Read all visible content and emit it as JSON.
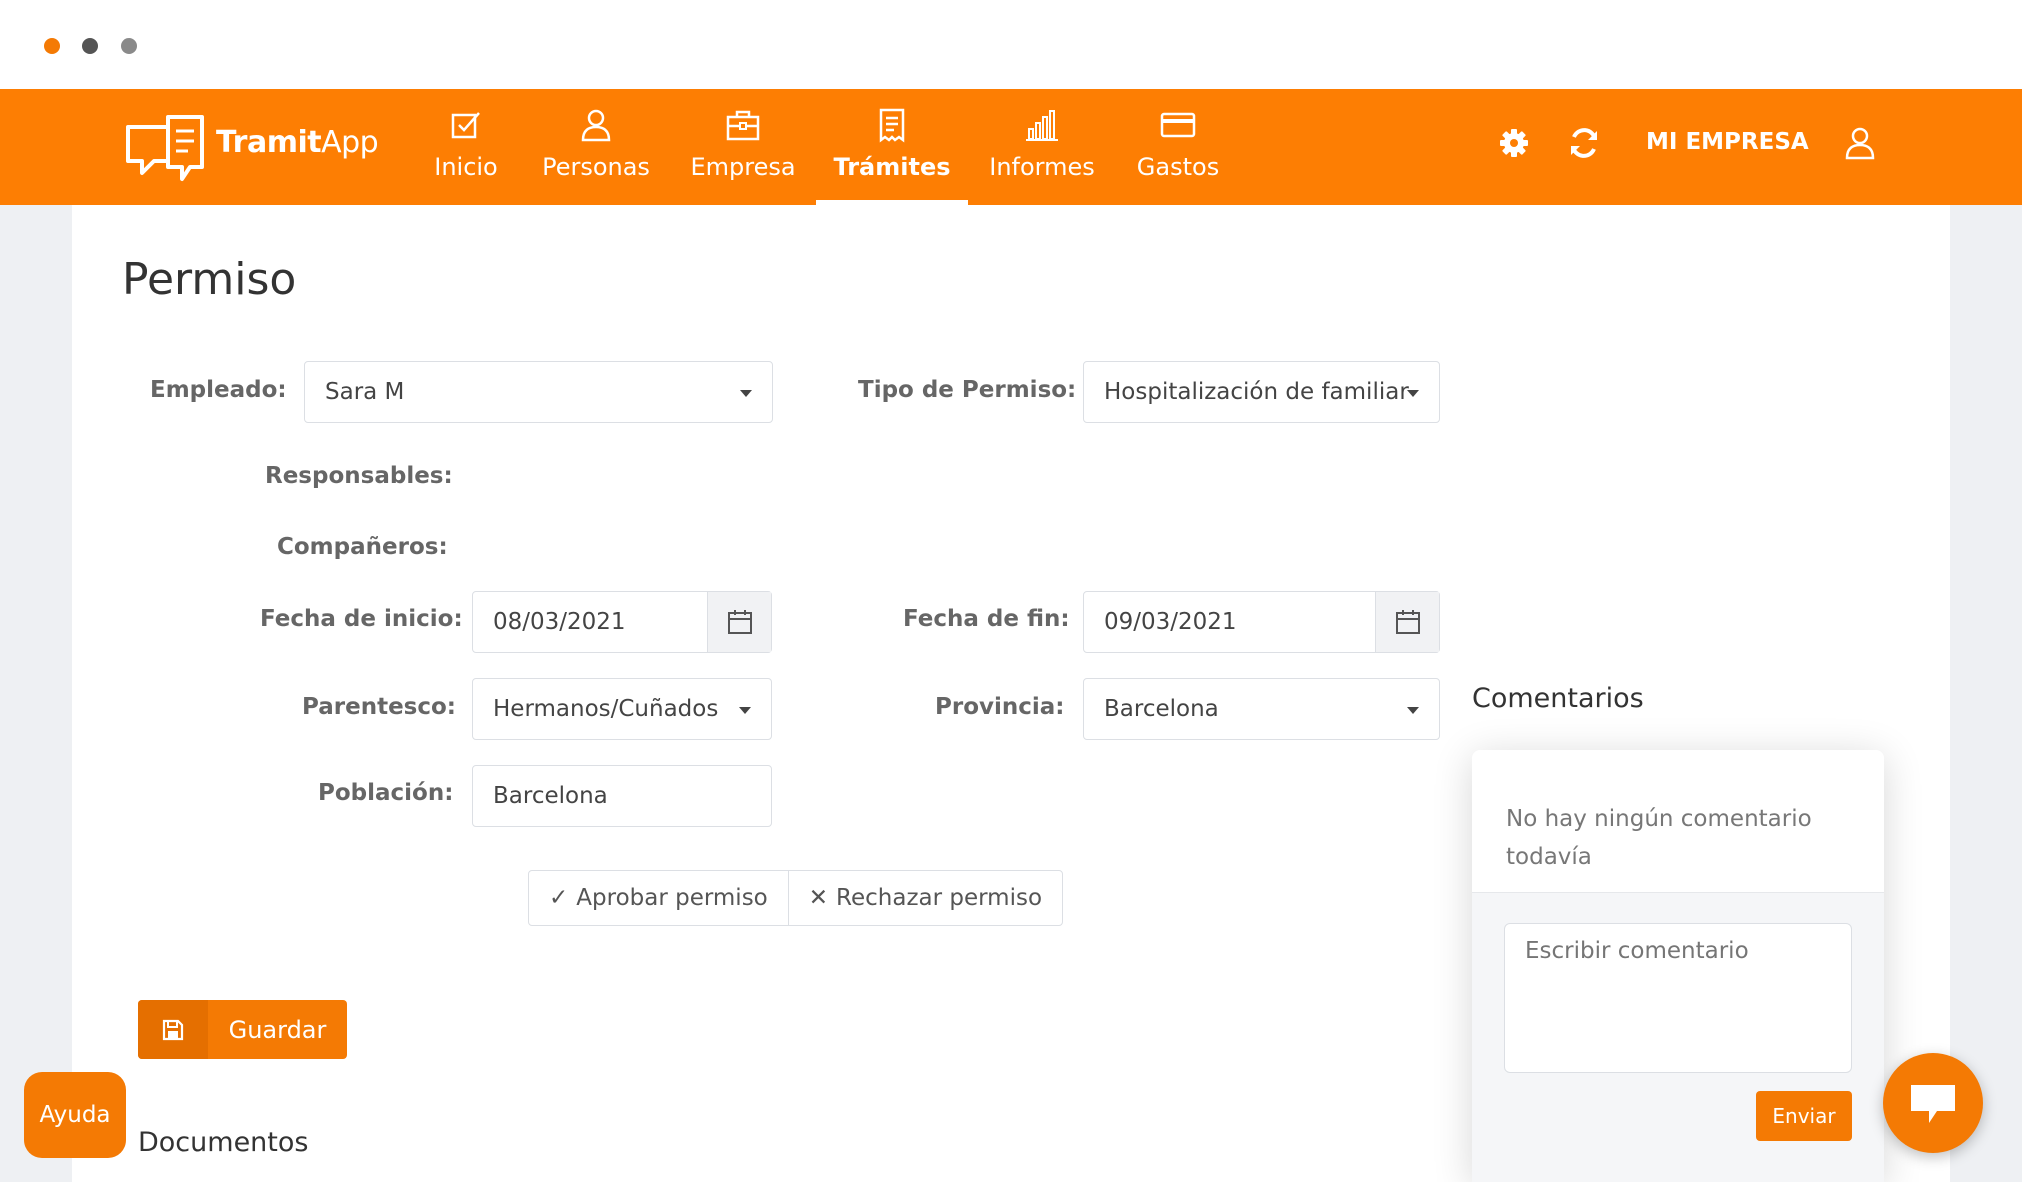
{
  "window": {
    "dots": [
      "#f47a04",
      "#555555",
      "#8a8a8a"
    ]
  },
  "brand": {
    "name_bold": "Tramit",
    "name_rest": "App",
    "color": "#fd7e03"
  },
  "nav": {
    "items": [
      {
        "label": "Inicio",
        "icon": "checkbox-icon",
        "active": false
      },
      {
        "label": "Personas",
        "icon": "person-icon",
        "active": false
      },
      {
        "label": "Empresa",
        "icon": "briefcase-icon",
        "active": false
      },
      {
        "label": "Trámites",
        "icon": "receipt-icon",
        "active": true
      },
      {
        "label": "Informes",
        "icon": "bar-chart-icon",
        "active": false
      },
      {
        "label": "Gastos",
        "icon": "credit-card-icon",
        "active": false
      }
    ],
    "company": "MI EMPRESA",
    "right_icons": [
      "gear-icon",
      "refresh-icon",
      "user-icon"
    ]
  },
  "page": {
    "title": "Permiso"
  },
  "form": {
    "empleado_label": "Empleado:",
    "empleado_value": "Sara M",
    "tipo_label": "Tipo de Permiso:",
    "tipo_value": "Hospitalización de familiar",
    "responsables_label": "Responsables:",
    "companeros_label": "Compañeros:",
    "fecha_inicio_label": "Fecha de inicio:",
    "fecha_inicio_value": "08/03/2021",
    "fecha_fin_label": "Fecha de fin:",
    "fecha_fin_value": "09/03/2021",
    "parentesco_label": "Parentesco:",
    "parentesco_value": "Hermanos/Cuñados",
    "provincia_label": "Provincia:",
    "provincia_value": "Barcelona",
    "poblacion_label": "Población:",
    "poblacion_value": "Barcelona"
  },
  "actions": {
    "approve": "Aprobar permiso",
    "approve_glyph": "✓",
    "reject": "Rechazar permiso",
    "reject_glyph": "✕",
    "save": "Guardar"
  },
  "documents": {
    "title": "Documentos"
  },
  "help": {
    "label": "Ayuda"
  },
  "comments": {
    "title": "Comentarios",
    "empty_text": "No hay ningún comentario todavía",
    "input_placeholder": "Escribir comentario",
    "send": "Enviar"
  }
}
